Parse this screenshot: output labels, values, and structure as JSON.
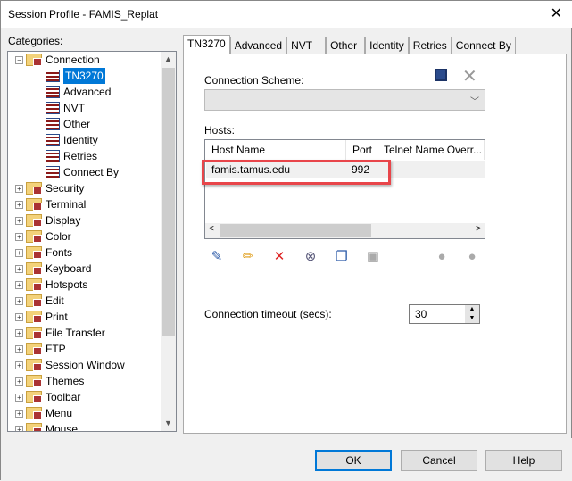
{
  "window": {
    "title": "Session Profile - FAMIS_Replat",
    "close": "✕"
  },
  "categories": {
    "label": "Categories:",
    "connection": "Connection",
    "children": [
      "TN3270",
      "Advanced",
      "NVT",
      "Other",
      "Identity",
      "Retries",
      "Connect By"
    ],
    "selected": "TN3270",
    "others": [
      "Security",
      "Terminal",
      "Display",
      "Color",
      "Fonts",
      "Keyboard",
      "Hotspots",
      "Edit",
      "Print",
      "File Transfer",
      "FTP",
      "Session Window",
      "Themes",
      "Toolbar",
      "Menu",
      "Mouse"
    ]
  },
  "tabs": [
    "TN3270",
    "Advanced",
    "NVT",
    "Other",
    "Identity",
    "Retries",
    "Connect By"
  ],
  "panel": {
    "scheme_label": "Connection Scheme:",
    "scheme_value": "",
    "hosts_label": "Hosts:",
    "columns": [
      "Host Name",
      "Port",
      "Telnet Name Overr..."
    ],
    "rows": [
      {
        "host": "famis.tamus.edu",
        "port": "992",
        "telnet": ""
      }
    ],
    "timeout_label": "Connection timeout (secs):",
    "timeout_value": "30",
    "highlight_color": "#e8454a"
  },
  "buttons": {
    "ok": "OK",
    "cancel": "Cancel",
    "help": "Help"
  }
}
